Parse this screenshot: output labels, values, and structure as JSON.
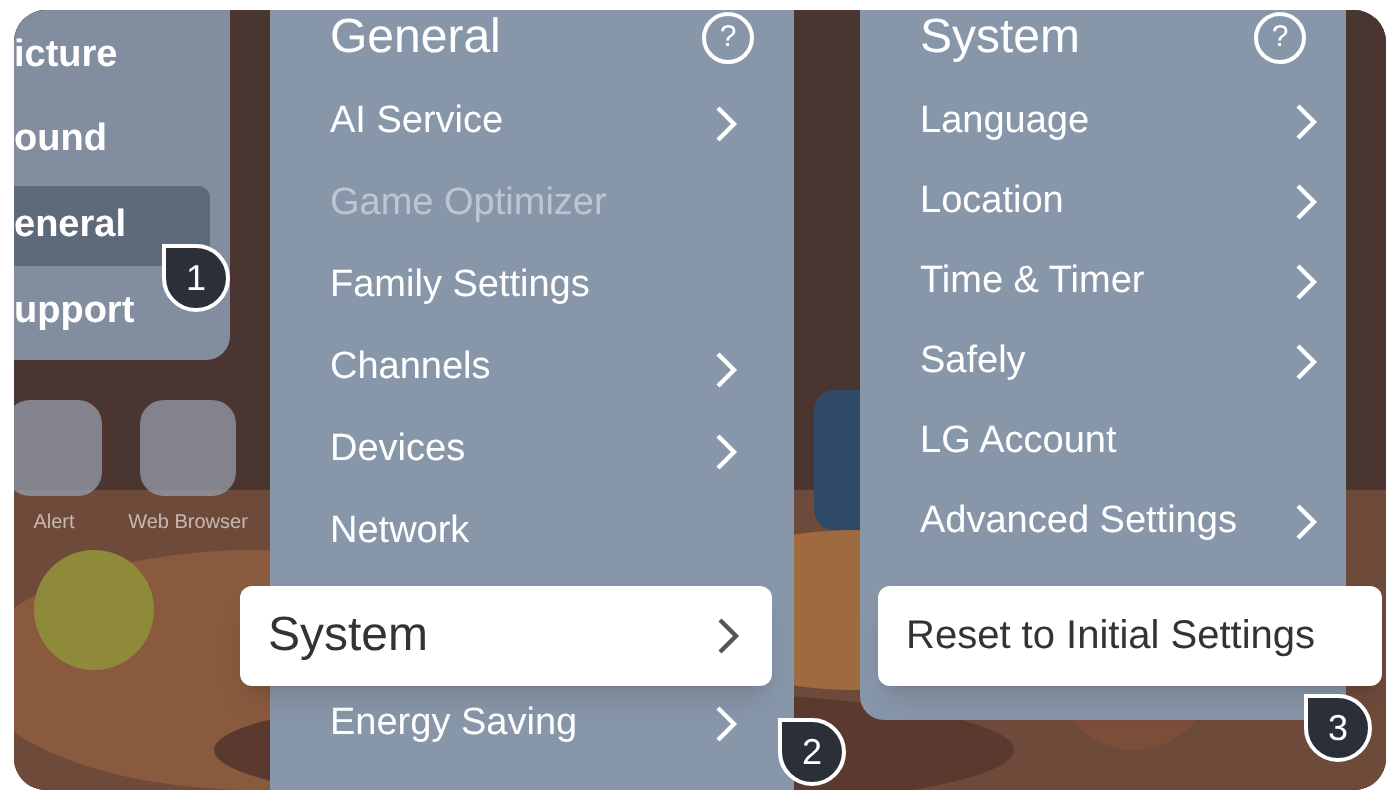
{
  "sidebar": {
    "items": [
      {
        "label": "icture",
        "selected": false
      },
      {
        "label": "ound",
        "selected": false
      },
      {
        "label": "eneral",
        "selected": true
      },
      {
        "label": "upport",
        "selected": false
      }
    ]
  },
  "apps": [
    {
      "label": "Alert"
    },
    {
      "label": "Web Browser"
    }
  ],
  "general_menu": {
    "title": "General",
    "help": "?",
    "items": [
      {
        "label": "AI Service",
        "submenu": true,
        "disabled": false,
        "selected": false
      },
      {
        "label": "Game Optimizer",
        "submenu": false,
        "disabled": true,
        "selected": false
      },
      {
        "label": "Family Settings",
        "submenu": false,
        "disabled": false,
        "selected": false
      },
      {
        "label": "Channels",
        "submenu": true,
        "disabled": false,
        "selected": false
      },
      {
        "label": "Devices",
        "submenu": true,
        "disabled": false,
        "selected": false
      },
      {
        "label": "Network",
        "submenu": false,
        "disabled": false,
        "selected": false
      },
      {
        "label": "System",
        "submenu": true,
        "disabled": false,
        "selected": true
      },
      {
        "label": "Energy Saving",
        "submenu": true,
        "disabled": false,
        "selected": false
      }
    ]
  },
  "system_menu": {
    "title": "System",
    "help": "?",
    "items": [
      {
        "label": "Language",
        "submenu": true,
        "disabled": false,
        "selected": false
      },
      {
        "label": "Location",
        "submenu": true,
        "disabled": false,
        "selected": false
      },
      {
        "label": "Time & Timer",
        "submenu": true,
        "disabled": false,
        "selected": false
      },
      {
        "label": "Safely",
        "submenu": true,
        "disabled": false,
        "selected": false
      },
      {
        "label": "LG Account",
        "submenu": false,
        "disabled": false,
        "selected": false
      },
      {
        "label": "Advanced Settings",
        "submenu": true,
        "disabled": false,
        "selected": false
      },
      {
        "label": "Reset to Initial Settings",
        "submenu": false,
        "disabled": false,
        "selected": true
      }
    ]
  },
  "step_markers": [
    "1",
    "2",
    "3"
  ]
}
